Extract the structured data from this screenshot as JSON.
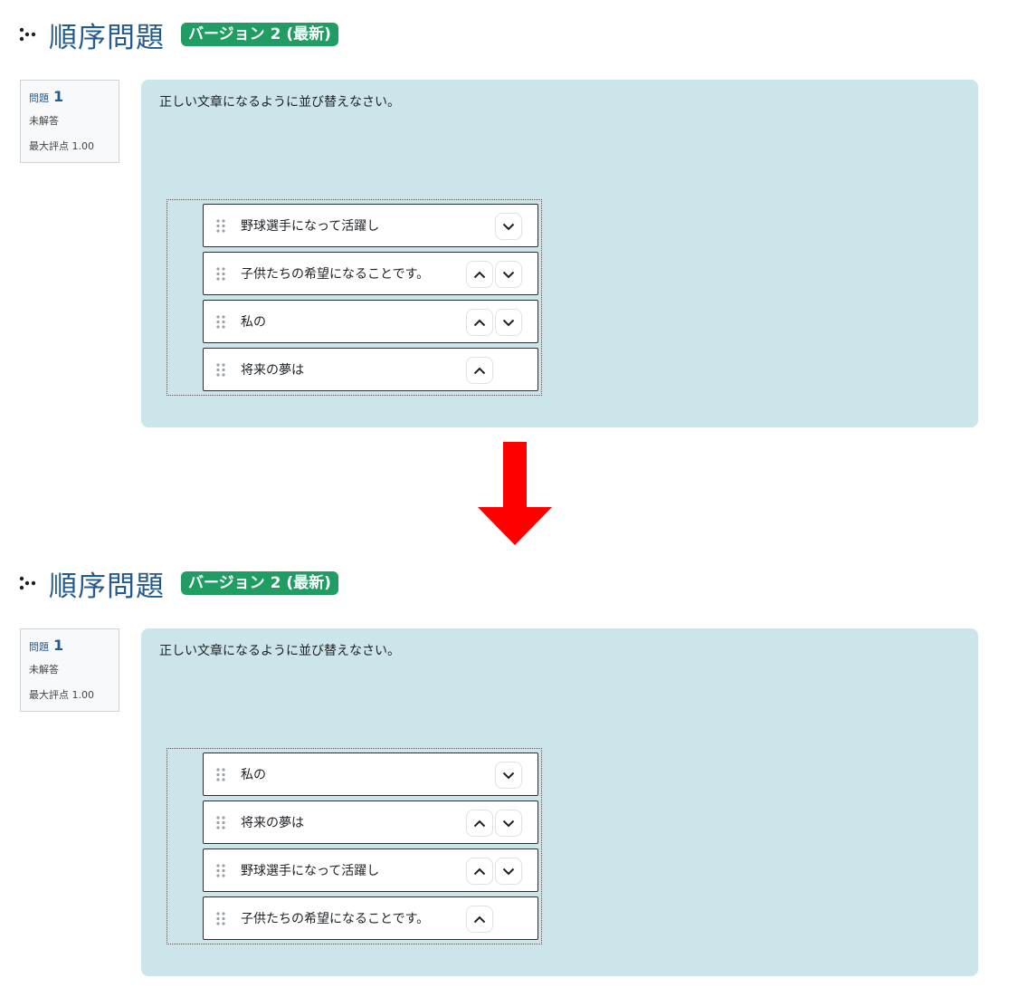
{
  "colors": {
    "title": "#245b8f",
    "badge": "#1f9d63",
    "content_bg": "#cce5ea",
    "arrow": "#ff0000"
  },
  "icons": {
    "question_type": "ordering-dots-icon",
    "grip": "drag-handle-icon",
    "up": "chevron-up-icon",
    "down": "chevron-down-icon",
    "transition": "down-arrow-icon"
  },
  "before": {
    "title": "順序問題",
    "version": "バージョン 2 (最新)",
    "info": {
      "label": "問題",
      "number": "1",
      "state": "未解答",
      "grade": "最大評点 1.00"
    },
    "question_text": "正しい文章になるように並び替えなさい。",
    "items": [
      {
        "label": "野球選手になって活躍し"
      },
      {
        "label": "子供たちの希望になることです。"
      },
      {
        "label": "私の"
      },
      {
        "label": "将来の夢は"
      }
    ]
  },
  "after": {
    "title": "順序問題",
    "version": "バージョン 2 (最新)",
    "info": {
      "label": "問題",
      "number": "1",
      "state": "未解答",
      "grade": "最大評点 1.00"
    },
    "question_text": "正しい文章になるように並び替えなさい。",
    "items": [
      {
        "label": "私の"
      },
      {
        "label": "将来の夢は"
      },
      {
        "label": "野球選手になって活躍し"
      },
      {
        "label": "子供たちの希望になることです。"
      }
    ]
  }
}
